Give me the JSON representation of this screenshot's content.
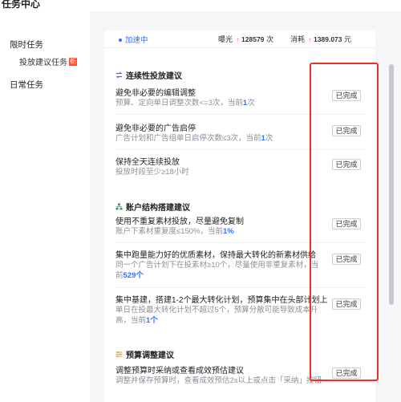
{
  "window": {
    "title": "任务中心"
  },
  "sidebar": {
    "group1": "限时任务",
    "sub_item": "投放建议任务",
    "new_badge": "新",
    "group2": "日常任务"
  },
  "stats": {
    "speed_label": "加速中",
    "exposure_label": "曝光",
    "exposure_value": "128579",
    "exposure_unit": "次",
    "spend_label": "消耗",
    "spend_value": "1389.073",
    "spend_unit": "元"
  },
  "sections": [
    {
      "heading": "连续性投放建议",
      "items": [
        {
          "title": "避免非必要的编辑调整",
          "desc_pre": "预算、定向单日调整次数<=3次，当前",
          "desc_val": "1",
          "desc_post": "次",
          "status": "已完成"
        },
        {
          "title": "避免非必要的广告启停",
          "desc_pre": "广告计划和广告组单日启停次数≤3次，当前",
          "desc_val": "1",
          "desc_post": "次",
          "status": "已完成"
        },
        {
          "title": "保持全天连续投放",
          "desc_pre": "投放时段至少≥18小时",
          "desc_val": "",
          "desc_post": "",
          "status": "已完成"
        }
      ]
    },
    {
      "heading": "账户结构搭建建议",
      "items": [
        {
          "title": "使用不重复素材投放，尽量避免复制",
          "desc_pre": "账户下素材重复度≤150%，当前",
          "desc_val": "1%",
          "desc_post": "",
          "status": "已完成"
        },
        {
          "title": "集中跑量能力好的优质素材，保持最大转化的新素材供给",
          "desc_pre": "同一个广告计划下在投素材≥10个，尽量使用非重复素材，当前",
          "desc_val": "529个",
          "desc_post": "",
          "status": "已完成"
        },
        {
          "title": "集中基建，搭建1-2个最大转化计划，预算集中在头部计划上",
          "desc_pre": "单日在投最大转化计划不超过5个，预算分散可能导致成本升高，当前",
          "desc_val": "1个",
          "desc_post": "",
          "status": "已完成"
        }
      ]
    },
    {
      "heading": "预算调整建议",
      "items": [
        {
          "title": "调整预算时采纳或查看成效预估建议",
          "desc_pre": "调整并保存预算时，查看成效预估2s以上或点击「采纳」按钮",
          "desc_val": "",
          "desc_post": "",
          "status": "已完成"
        }
      ]
    }
  ],
  "colors": {
    "accent": "#3370ff",
    "highlight_box": "#e8312a",
    "new_badge": "#ff4d2e"
  }
}
